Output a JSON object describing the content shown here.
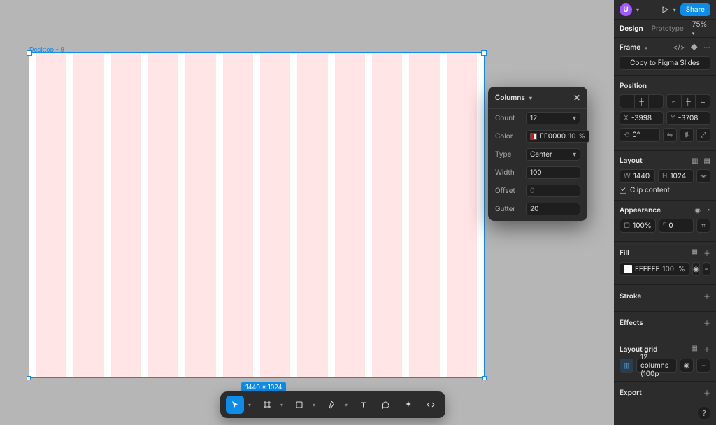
{
  "canvas": {
    "frame_label": "Desktop - 9",
    "dimensions_badge": "1440 × 1024"
  },
  "columns_popover": {
    "title": "Columns",
    "close": "✕",
    "rows": {
      "count_label": "Count",
      "count_value": "12",
      "color_label": "Color",
      "color_hex": "FF0000",
      "color_opacity": "10",
      "color_unit": "%",
      "type_label": "Type",
      "type_value": "Center",
      "width_label": "Width",
      "width_value": "100",
      "offset_label": "Offset",
      "offset_value": "0",
      "gutter_label": "Gutter",
      "gutter_value": "20"
    }
  },
  "header": {
    "avatar_letter": "U",
    "share_label": "Share"
  },
  "tabs": {
    "design": "Design",
    "prototype": "Prototype",
    "zoom": "75%"
  },
  "inspector": {
    "frame": {
      "title": "Frame",
      "copy_button": "Copy to Figma Slides"
    },
    "position": {
      "title": "Position",
      "x_label": "X",
      "x_value": "-3998",
      "y_label": "Y",
      "y_value": "-3708",
      "rotation_icon": "⟲",
      "rotation_value": "0°"
    },
    "layout": {
      "title": "Layout",
      "w_label": "W",
      "w_value": "1440",
      "h_label": "H",
      "h_value": "1024",
      "clip_label": "Clip content"
    },
    "appearance": {
      "title": "Appearance",
      "opacity": "100%",
      "radius": "0"
    },
    "fill": {
      "title": "Fill",
      "hex": "FFFFFF",
      "opacity": "100",
      "unit": "%"
    },
    "stroke": {
      "title": "Stroke"
    },
    "effects": {
      "title": "Effects"
    },
    "layout_grid": {
      "title": "Layout grid",
      "item": "12 columns (100p"
    },
    "export": {
      "title": "Export"
    }
  }
}
